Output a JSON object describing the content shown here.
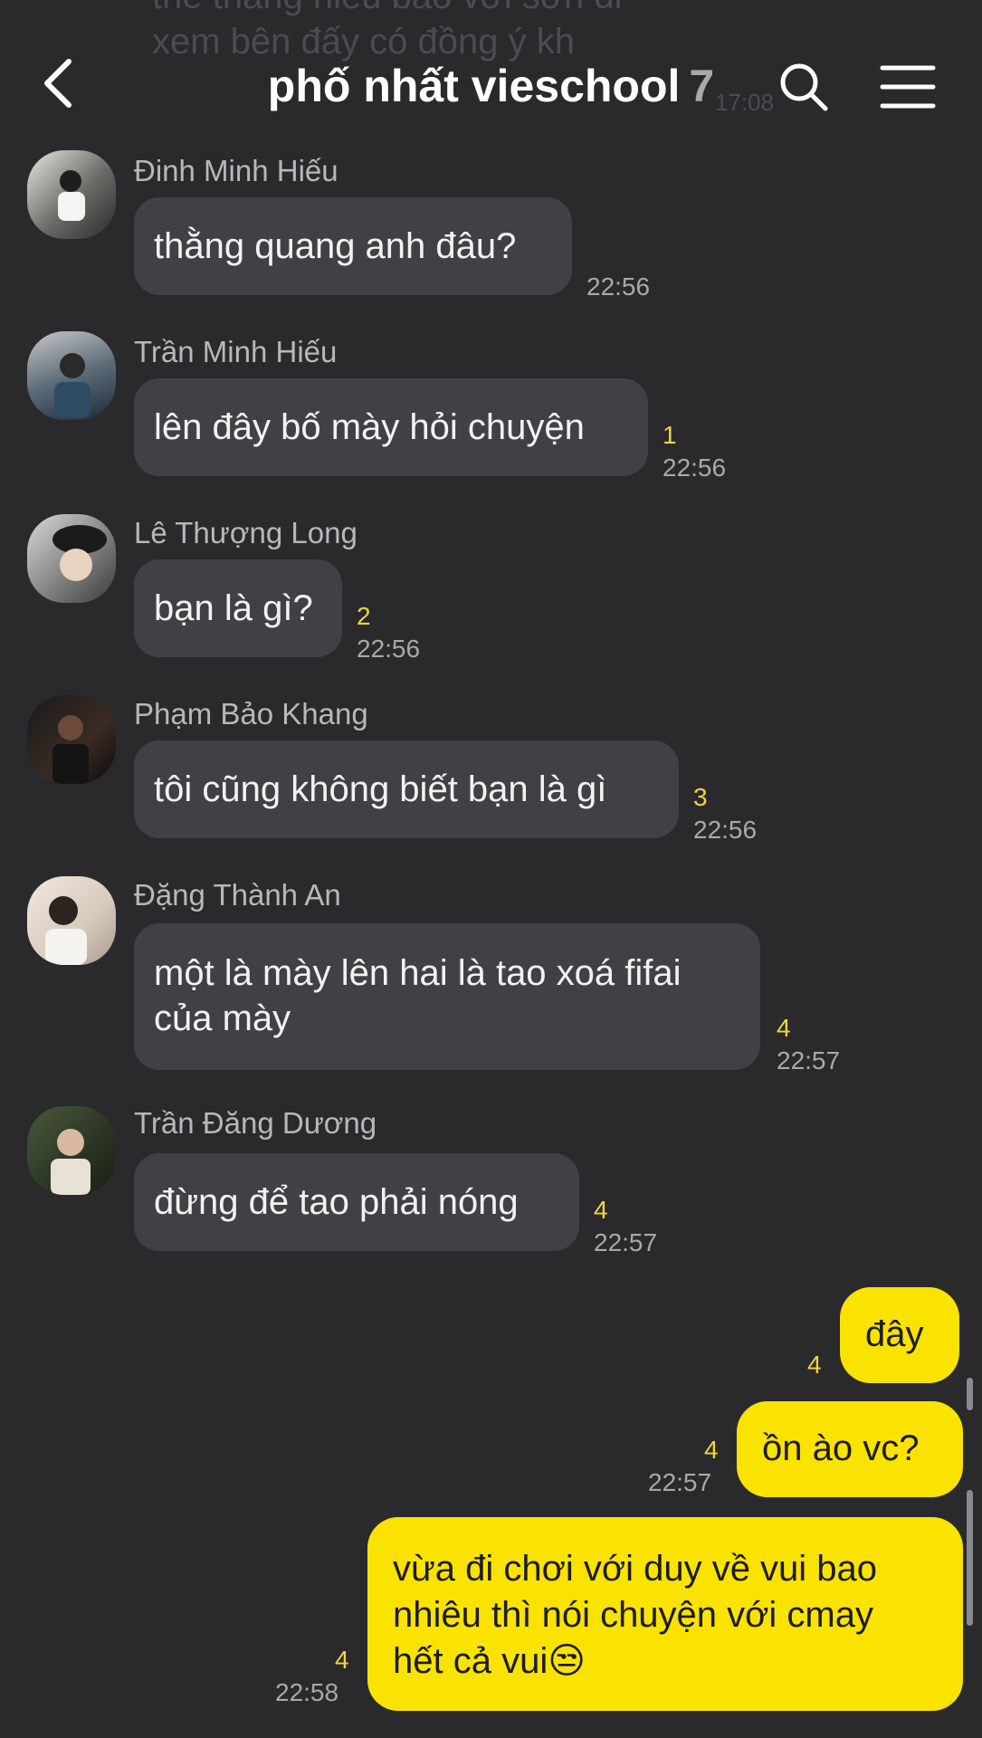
{
  "background_preview": {
    "line1": "thể thằng hiếu bảo với sơn đi",
    "line2": "xem bên đấy có đồng ý kh",
    "time": "17:08"
  },
  "header": {
    "title": "phố nhất vieschool",
    "member_count": "7",
    "icons": [
      "back-chevron-icon",
      "search-icon",
      "menu-icon"
    ]
  },
  "messages": [
    {
      "sender": "Đinh Minh Hiếu",
      "text": "thằng quang anh đâu?",
      "unread": "",
      "time": "22:56"
    },
    {
      "sender": "Trần Minh Hiếu",
      "text": "lên đây bố mày hỏi chuyện",
      "unread": "1",
      "time": "22:56"
    },
    {
      "sender": "Lê Thượng Long",
      "text": "bạn là gì?",
      "unread": "2",
      "time": "22:56"
    },
    {
      "sender": "Phạm Bảo Khang",
      "text": "tôi cũng không biết bạn là gì",
      "unread": "3",
      "time": "22:56"
    },
    {
      "sender": "Đặng Thành An",
      "text": "một là mày lên hai là tao xoá fifai\ncủa mày",
      "unread": "4",
      "time": "22:57"
    },
    {
      "sender": "Trần Đăng Dương",
      "text": "đừng để tao phải nóng",
      "unread": "4",
      "time": "22:57"
    }
  ],
  "my_messages": [
    {
      "text": "đây",
      "unread": "4",
      "time": ""
    },
    {
      "text": "ồn ào vc?",
      "unread": "4",
      "time": "22:57"
    },
    {
      "text": "vừa đi chơi với duy về vui bao\nnhiêu thì nói chuyện với cmay\nhết cả vui😒",
      "unread": "4",
      "time": "22:58"
    }
  ],
  "colors": {
    "background": "#2a2a2d",
    "incoming_bubble": "#414145",
    "outgoing_bubble": "#fbe300",
    "unread_count": "#f3d43a"
  }
}
